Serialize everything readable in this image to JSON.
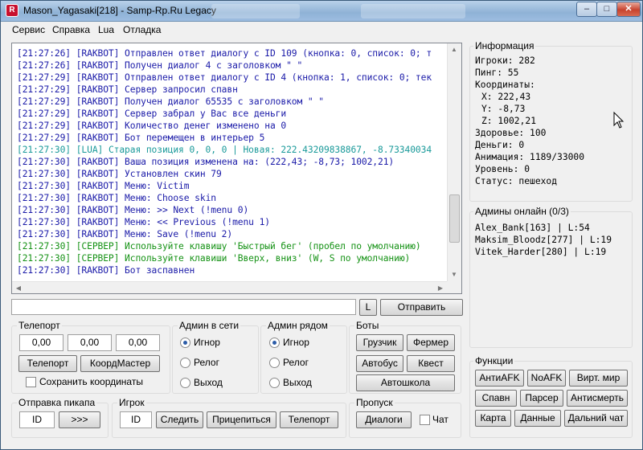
{
  "window": {
    "title": "Mason_Yagasaki[218] - Samp-Rp.Ru Legacy",
    "app_icon": "R",
    "controls": {
      "minimize": "–",
      "maximize": "□",
      "close": "✕"
    }
  },
  "menu": [
    "Сервис",
    "Справка",
    "Lua",
    "Отладка"
  ],
  "log": [
    {
      "time": "[21:27:26]",
      "tag": "[RAKBOT]",
      "text": "Отправлен ответ диалогу с ID 109 (кнопка: 0, список: 0; т",
      "color": "blue"
    },
    {
      "time": "[21:27:26]",
      "tag": "[RAKBOT]",
      "text": "Получен диалог 4 с заголовком \" \"",
      "color": "blue"
    },
    {
      "time": "[21:27:29]",
      "tag": "[RAKBOT]",
      "text": "Отправлен ответ диалогу с ID 4 (кнопка: 1, список: 0; тек",
      "color": "blue"
    },
    {
      "time": "[21:27:29]",
      "tag": "[RAKBOT]",
      "text": "Сервер запросил спавн",
      "color": "blue"
    },
    {
      "time": "[21:27:29]",
      "tag": "[RAKBOT]",
      "text": "Получен диалог 65535 с заголовком \" \"",
      "color": "blue"
    },
    {
      "time": "[21:27:29]",
      "tag": "[RAKBOT]",
      "text": "Сервер забрал у Вас все деньги",
      "color": "blue"
    },
    {
      "time": "[21:27:29]",
      "tag": "[RAKBOT]",
      "text": "Количество денег изменено на 0",
      "color": "blue"
    },
    {
      "time": "[21:27:29]",
      "tag": "[RAKBOT]",
      "text": "Бот перемещен в интерьер 5",
      "color": "blue"
    },
    {
      "time": "[21:27:30]",
      "tag": "[LUA]",
      "text": "Старая позиция 0, 0, 0 | Новая: 222.43209838867, -8.73340034",
      "color": "teal"
    },
    {
      "time": "[21:27:30]",
      "tag": "[RAKBOT]",
      "text": "Ваша позиция изменена на: (222,43; -8,73; 1002,21)",
      "color": "blue"
    },
    {
      "time": "[21:27:30]",
      "tag": "[RAKBOT]",
      "text": "Установлен скин 79",
      "color": "blue"
    },
    {
      "time": "[21:27:30]",
      "tag": "[RAKBOT]",
      "text": "Меню: Victim",
      "color": "blue"
    },
    {
      "time": "[21:27:30]",
      "tag": "[RAKBOT]",
      "text": "Меню: Choose skin",
      "color": "blue"
    },
    {
      "time": "[21:27:30]",
      "tag": "[RAKBOT]",
      "text": "Меню: >> Next (!menu 0)",
      "color": "blue"
    },
    {
      "time": "[21:27:30]",
      "tag": "[RAKBOT]",
      "text": "Меню: << Previous (!menu 1)",
      "color": "blue"
    },
    {
      "time": "[21:27:30]",
      "tag": "[RAKBOT]",
      "text": "Меню: Save (!menu 2)",
      "color": "blue"
    },
    {
      "time": "[21:27:30]",
      "tag": "[СЕРВЕР]",
      "text": " Используйте клавишу 'Быстрый бег' (пробел по умолчанию)",
      "color": "green"
    },
    {
      "time": "[21:27:30]",
      "tag": "[СЕРВЕР]",
      "text": " Используйте клавиши 'Вверх, вниз' (W, S по умолчанию)",
      "color": "green"
    },
    {
      "time": "[21:27:30]",
      "tag": "[RAKBOT]",
      "text": "Бот заспавнен",
      "color": "blue"
    }
  ],
  "colors": {
    "blue": "#1a1aa8",
    "teal": "#1a9a9a",
    "green": "#159215"
  },
  "command": {
    "value": "",
    "l_button": "L",
    "send_button": "Отправить"
  },
  "teleport": {
    "title": "Телепорт",
    "x": "0,00",
    "y": "0,00",
    "z": "0,00",
    "teleport_button": "Телепорт",
    "coord_master_button": "КоордМастер",
    "save_coords_label": "Сохранить координаты"
  },
  "admins_online": {
    "title": "Админ в сети",
    "options": [
      "Игнор",
      "Релог",
      "Выход"
    ],
    "selected": 0
  },
  "admins_near": {
    "title": "Админ рядом",
    "options": [
      "Игнор",
      "Релог",
      "Выход"
    ],
    "selected": 0
  },
  "bots": {
    "title": "Боты",
    "loader": "Грузчик",
    "farmer": "Фермер",
    "bus": "Автобус",
    "quest": "Квест",
    "driving_school": "Автошкола"
  },
  "pickup": {
    "title": "Отправка пикапа",
    "id_value": "ID",
    "send": ">>>"
  },
  "player": {
    "title": "Игрок",
    "id_value": "ID",
    "follow": "Следить",
    "attach": "Прицепиться",
    "teleport": "Телепорт"
  },
  "skip": {
    "title": "Пропуск",
    "dialogs": "Диалоги",
    "chat_label": "Чат"
  },
  "info": {
    "title": "Информация",
    "players": "Игроки: 282",
    "ping": "Пинг: 55",
    "coords_label": "Координаты:",
    "x": "X: 222,43",
    "y": "Y: -8,73",
    "z": "Z: 1002,21",
    "health": "Здоровье: 100",
    "money": "Деньги: 0",
    "animation": "Анимация: 1189/33000",
    "level": "Уровень: 0",
    "status": "Статус: пешеход"
  },
  "admins": {
    "title": "Админы онлайн (0/3)",
    "list": [
      "Alex_Bank[163] | L:54",
      "Maksim_Bloodz[277] | L:19",
      "Vitek_Harder[280] | L:19"
    ]
  },
  "functions": {
    "title": "Функции",
    "buttons": [
      "АнтиAFK",
      "NoAFK",
      "Вирт. мир",
      "Спавн",
      "Парсер",
      "Антисмерть",
      "Карта",
      "Данные",
      "Дальний чат"
    ]
  }
}
